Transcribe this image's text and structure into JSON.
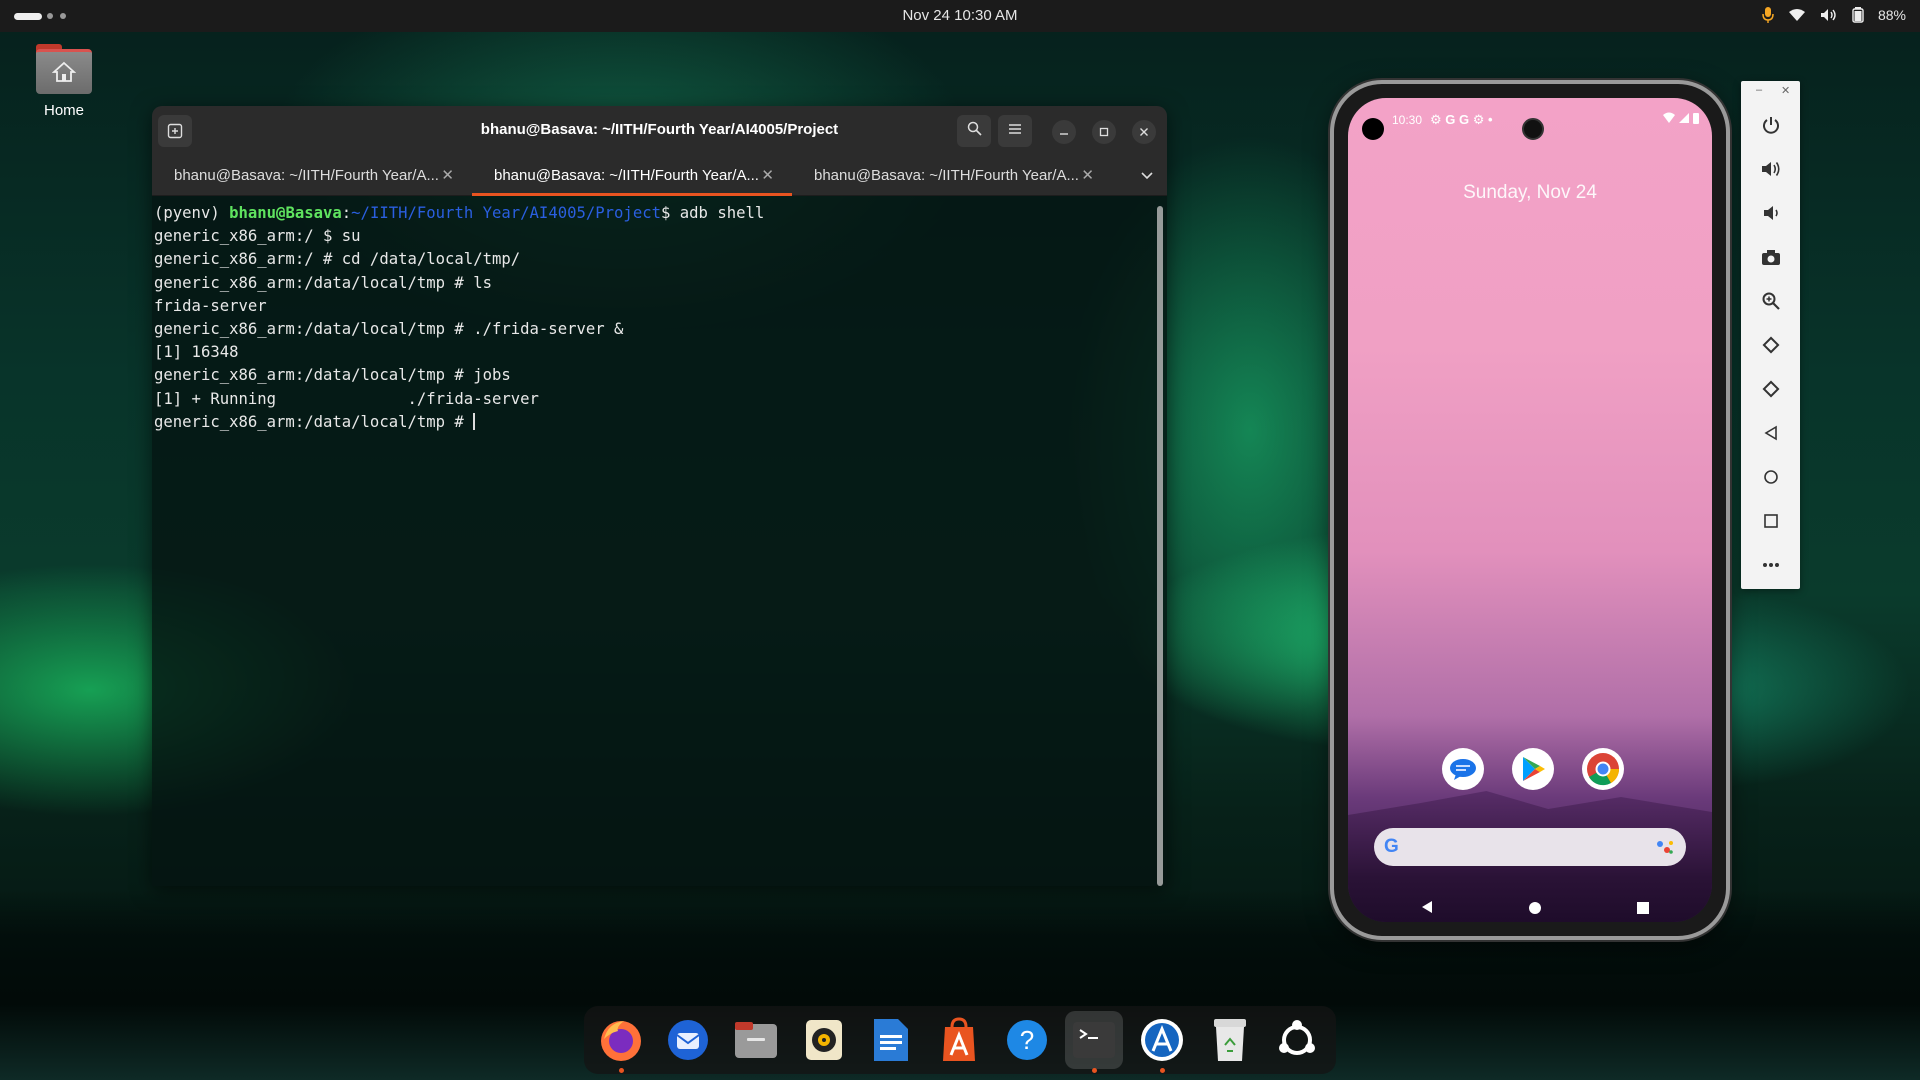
{
  "topbar": {
    "datetime": "Nov 24  10:30 AM",
    "battery": "88%"
  },
  "desktop": {
    "home_label": "Home"
  },
  "terminal": {
    "title": "bhanu@Basava: ~/IITH/Fourth Year/AI4005/Project",
    "tabs": [
      {
        "label": "bhanu@Basava: ~/IITH/Fourth Year/A...",
        "active": false
      },
      {
        "label": "bhanu@Basava: ~/IITH/Fourth Year/A...",
        "active": true
      },
      {
        "label": "bhanu@Basava: ~/IITH/Fourth Year/A...",
        "active": false
      }
    ],
    "prompt_env": "(pyenv) ",
    "prompt_user": "bhanu@Basava",
    "prompt_sep": ":",
    "prompt_path": "~/IITH/Fourth Year/AI4005/Project",
    "prompt_cmd": "$ adb shell",
    "lines": [
      "generic_x86_arm:/ $ su",
      "generic_x86_arm:/ # cd /data/local/tmp/",
      "generic_x86_arm:/data/local/tmp # ls",
      "frida-server",
      "generic_x86_arm:/data/local/tmp # ./frida-server &",
      "[1] 16348",
      "generic_x86_arm:/data/local/tmp # jobs",
      "[1] + Running              ./frida-server"
    ],
    "last_prompt": "generic_x86_arm:/data/local/tmp # "
  },
  "phone": {
    "status_time": "10:30",
    "date": "Sunday, Nov 24"
  },
  "emulator_panel": {
    "buttons": [
      "power-icon",
      "volume-up-icon",
      "volume-down-icon",
      "camera-icon",
      "zoom-icon",
      "rotate-left-icon",
      "rotate-right-icon",
      "back-icon",
      "home-icon",
      "overview-icon",
      "more-icon"
    ]
  },
  "dock": {
    "apps": [
      "firefox",
      "thunderbird",
      "files",
      "rhythmbox",
      "libreoffice-writer",
      "app-center",
      "help",
      "terminal",
      "software-updater",
      "trash",
      "ubuntu-logo"
    ]
  },
  "colors": {
    "accent": "#e95420",
    "prompt_user": "#5fe35f",
    "prompt_path": "#2a5fe0"
  }
}
